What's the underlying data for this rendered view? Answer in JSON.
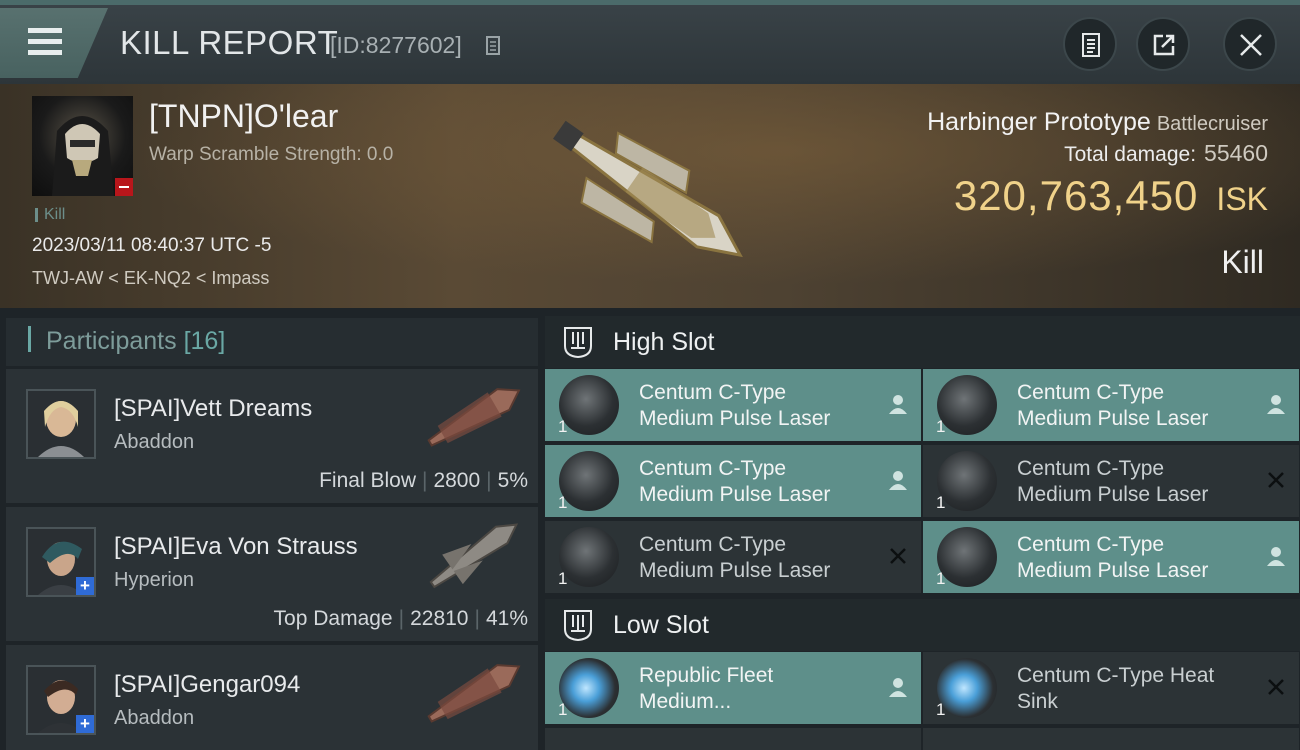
{
  "header": {
    "title": "KILL REPORT",
    "report_id": "[ID:8277602]"
  },
  "victim": {
    "name": "[TNPN]O'lear",
    "warp_scramble": "Warp Scramble Strength: 0.0",
    "tag": "Kill",
    "datetime": "2023/03/11 08:40:37 UTC -5",
    "location": "TWJ-AW < EK-NQ2 < Impass",
    "ship_name": "Harbinger Prototype",
    "ship_class": "Battlecruiser",
    "total_damage_label": "Total damage:",
    "total_damage": "55460",
    "isk_value": "320,763,450",
    "isk_unit": "ISK",
    "result": "Kill"
  },
  "participants": {
    "label": "Participants",
    "count": "[16]",
    "items": [
      {
        "name": "[SPAI]Vett Dreams",
        "ship": "Abaddon",
        "role": "Final Blow",
        "damage": "2800",
        "percent": "5%"
      },
      {
        "name": "[SPAI]Eva Von Strauss",
        "ship": "Hyperion",
        "role": "Top Damage",
        "damage": "22810",
        "percent": "41%"
      },
      {
        "name": "[SPAI]Gengar094",
        "ship": "Abaddon"
      }
    ]
  },
  "high_slot": {
    "title": "High Slot",
    "modules": [
      {
        "line1": "Centum C-Type",
        "line2": "Medium Pulse Laser",
        "qty": "1",
        "status": "dropped"
      },
      {
        "line1": "Centum C-Type",
        "line2": "Medium Pulse Laser",
        "qty": "1",
        "status": "dropped"
      },
      {
        "line1": "Centum C-Type",
        "line2": "Medium Pulse Laser",
        "qty": "1",
        "status": "dropped"
      },
      {
        "line1": "Centum C-Type",
        "line2": "Medium Pulse Laser",
        "qty": "1",
        "status": "destroyed"
      },
      {
        "line1": "Centum C-Type",
        "line2": "Medium Pulse Laser",
        "qty": "1",
        "status": "destroyed"
      },
      {
        "line1": "Centum C-Type",
        "line2": "Medium Pulse Laser",
        "qty": "1",
        "status": "dropped"
      }
    ]
  },
  "low_slot": {
    "title": "Low Slot",
    "modules": [
      {
        "line1": "Republic Fleet",
        "line2": "Medium...",
        "qty": "1",
        "status": "dropped"
      },
      {
        "line1": "Centum C-Type Heat",
        "line2": "Sink",
        "qty": "1",
        "status": "destroyed"
      }
    ]
  },
  "colors": {
    "accent_teal": "#5e8f8a",
    "isk_gold": "#f0d28a",
    "alert_red": "#b8161b"
  }
}
